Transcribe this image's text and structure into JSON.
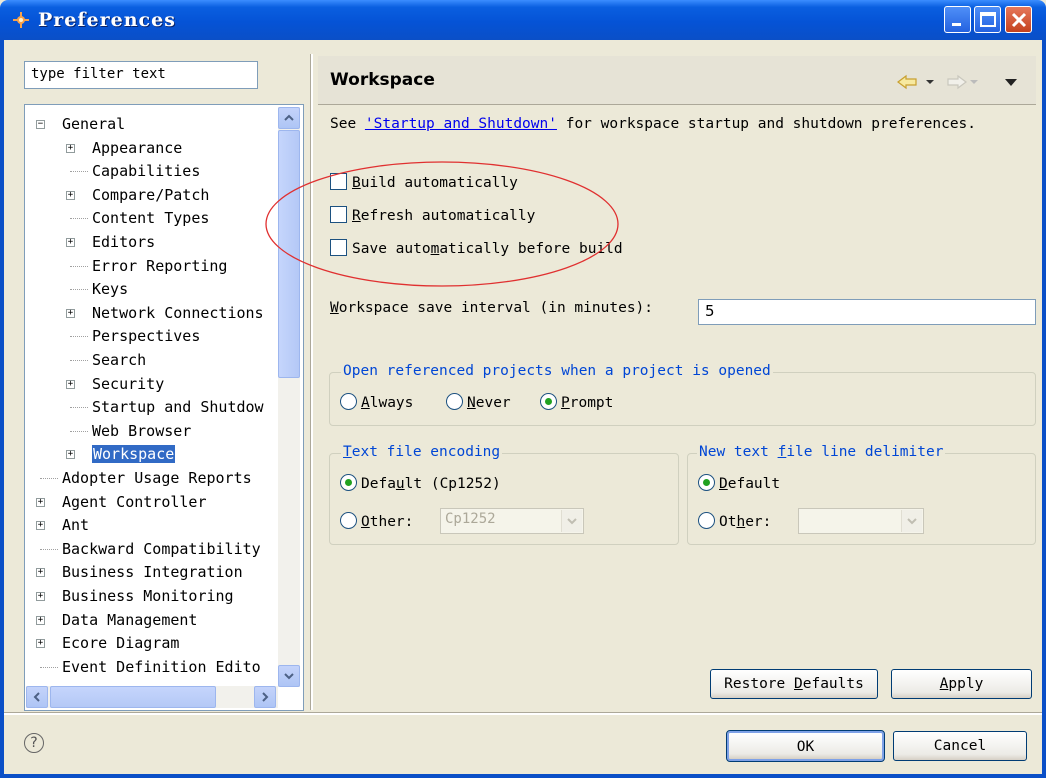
{
  "window": {
    "title": "Preferences"
  },
  "filter": {
    "placeholder": "type filter text",
    "value": "type filter text"
  },
  "tree": {
    "items": [
      {
        "label": "General",
        "level": 0,
        "expander": "minus"
      },
      {
        "label": "Appearance",
        "level": 1,
        "expander": "plus"
      },
      {
        "label": "Capabilities",
        "level": 1,
        "expander": "none"
      },
      {
        "label": "Compare/Patch",
        "level": 1,
        "expander": "plus"
      },
      {
        "label": "Content Types",
        "level": 1,
        "expander": "none"
      },
      {
        "label": "Editors",
        "level": 1,
        "expander": "plus"
      },
      {
        "label": "Error Reporting",
        "level": 1,
        "expander": "none"
      },
      {
        "label": "Keys",
        "level": 1,
        "expander": "none"
      },
      {
        "label": "Network Connections",
        "level": 1,
        "expander": "plus"
      },
      {
        "label": "Perspectives",
        "level": 1,
        "expander": "none"
      },
      {
        "label": "Search",
        "level": 1,
        "expander": "none"
      },
      {
        "label": "Security",
        "level": 1,
        "expander": "plus"
      },
      {
        "label": "Startup and Shutdow",
        "level": 1,
        "expander": "none"
      },
      {
        "label": "Web Browser",
        "level": 1,
        "expander": "none"
      },
      {
        "label": "Workspace",
        "level": 1,
        "expander": "plus",
        "selected": true
      },
      {
        "label": "Adopter Usage Reports",
        "level": 0,
        "expander": "none"
      },
      {
        "label": "Agent Controller",
        "level": 0,
        "expander": "plus"
      },
      {
        "label": "Ant",
        "level": 0,
        "expander": "plus"
      },
      {
        "label": "Backward Compatibility",
        "level": 0,
        "expander": "none"
      },
      {
        "label": "Business Integration",
        "level": 0,
        "expander": "plus"
      },
      {
        "label": "Business Monitoring",
        "level": 0,
        "expander": "plus"
      },
      {
        "label": "Data Management",
        "level": 0,
        "expander": "plus"
      },
      {
        "label": "Ecore Diagram",
        "level": 0,
        "expander": "plus"
      },
      {
        "label": "Event Definition Edito",
        "level": 0,
        "expander": "none"
      }
    ]
  },
  "page": {
    "title": "Workspace",
    "desc_prefix": "See ",
    "desc_link": "'Startup and Shutdown'",
    "desc_suffix": " for workspace startup and shutdown preferences.",
    "checkboxes": {
      "build": {
        "mnemonic": "B",
        "rest": "uild automatically",
        "checked": false
      },
      "refresh": {
        "mnemonic": "R",
        "rest": "efresh automatically",
        "checked": false
      },
      "save": {
        "pre": "Save auto",
        "mnemonic": "m",
        "rest": "atically before build",
        "checked": false
      }
    },
    "interval": {
      "mnemonic": "W",
      "rest": "orkspace save interval (in minutes):",
      "value": "5"
    },
    "open_projects": {
      "legend": "Open referenced projects when a project is opened",
      "always": {
        "mnemonic": "A",
        "rest": "lways"
      },
      "never": {
        "mnemonic": "N",
        "rest": "ever"
      },
      "prompt": {
        "mnemonic": "P",
        "rest": "rompt"
      },
      "selected": "prompt"
    },
    "encoding": {
      "legend_pre": "",
      "legend_mnemonic": "T",
      "legend_rest": "ext file encoding",
      "default_pre": "Defa",
      "default_mnemonic": "u",
      "default_rest": "lt (Cp1252)",
      "other_mnemonic": "O",
      "other_rest": "ther:",
      "other_value": "Cp1252",
      "selected": "default"
    },
    "delimiter": {
      "legend_pre": "New text ",
      "legend_mnemonic": "f",
      "legend_rest": "ile line delimiter",
      "default_pre": "",
      "default_mnemonic": "D",
      "default_rest": "efault",
      "other_pre": "Ot",
      "other_mnemonic": "h",
      "other_rest": "er:",
      "other_value": "",
      "selected": "default"
    },
    "restore_pre": "Restore ",
    "restore_mnemonic": "D",
    "restore_rest": "efaults",
    "apply_mnemonic": "A",
    "apply_rest": "pply"
  },
  "footer": {
    "ok": "OK",
    "cancel": "Cancel",
    "help": "?"
  },
  "colors": {
    "titlebar": "#0553d6",
    "selection": "#316ac5",
    "link": "#0000ee",
    "group_legend": "#0046d5",
    "annotation": "#e03030"
  }
}
